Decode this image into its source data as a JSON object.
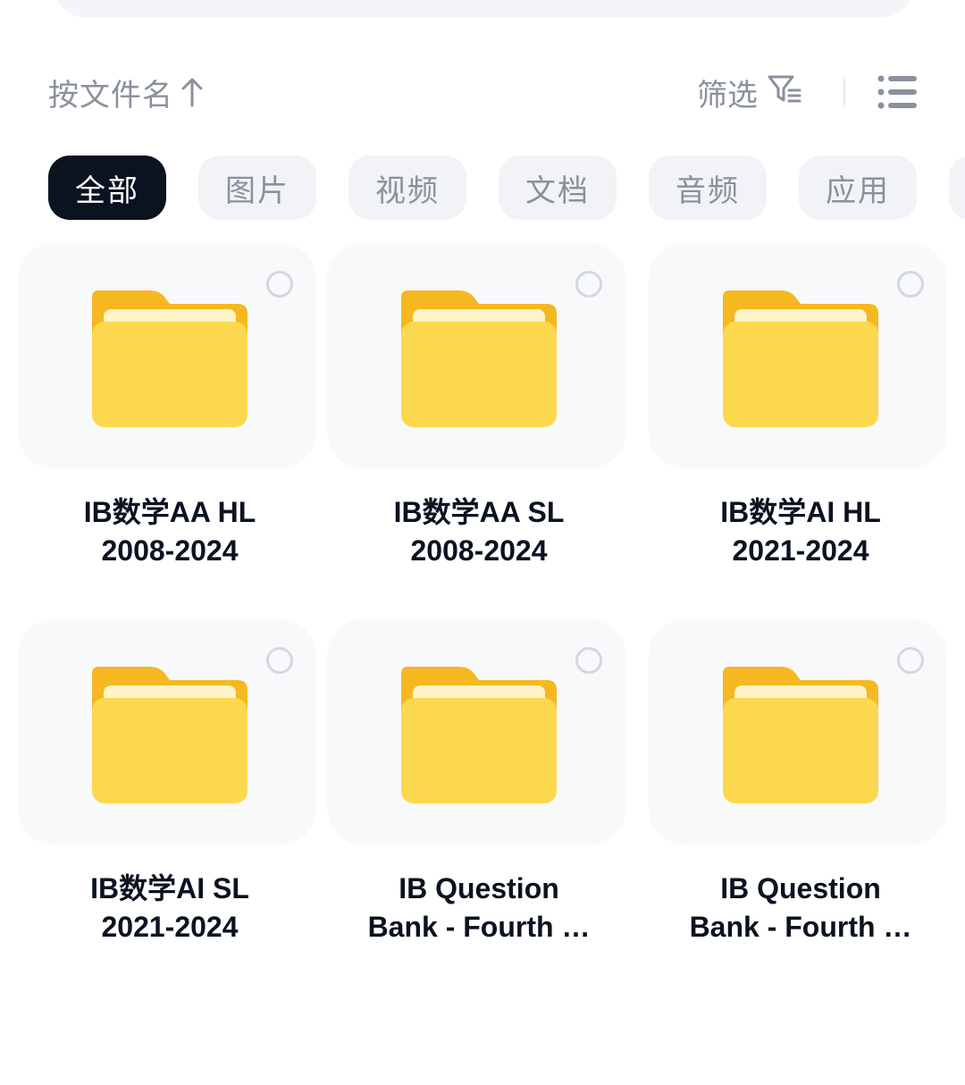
{
  "toolbar": {
    "sort_label": "按文件名",
    "filter_label": "筛选"
  },
  "categories": [
    "全部",
    "图片",
    "视频",
    "文档",
    "音频",
    "应用"
  ],
  "active_category": "全部",
  "files": [
    {
      "line1": "IB数学AA HL",
      "line2": "2008-2024",
      "type_icon": "folder-icon"
    },
    {
      "line1": "IB数学AA SL",
      "line2": "2008-2024",
      "type_icon": "folder-icon"
    },
    {
      "line1": "IB数学AI HL",
      "line2": "2021-2024",
      "type_icon": "folder-icon"
    },
    {
      "line1": "IB数学AI SL",
      "line2": "2021-2024",
      "type_icon": "folder-icon"
    },
    {
      "line1": "IB Question",
      "line2": "Bank - Fourth …",
      "type_icon": "folder-icon"
    },
    {
      "line1": "IB Question",
      "line2": "Bank - Fourth …",
      "type_icon": "folder-icon"
    }
  ],
  "colors": {
    "accent_dark": "#0b1220",
    "muted_text": "#8a919c",
    "folder_yellow": "#fcd34d",
    "folder_back": "#fbbf24"
  }
}
